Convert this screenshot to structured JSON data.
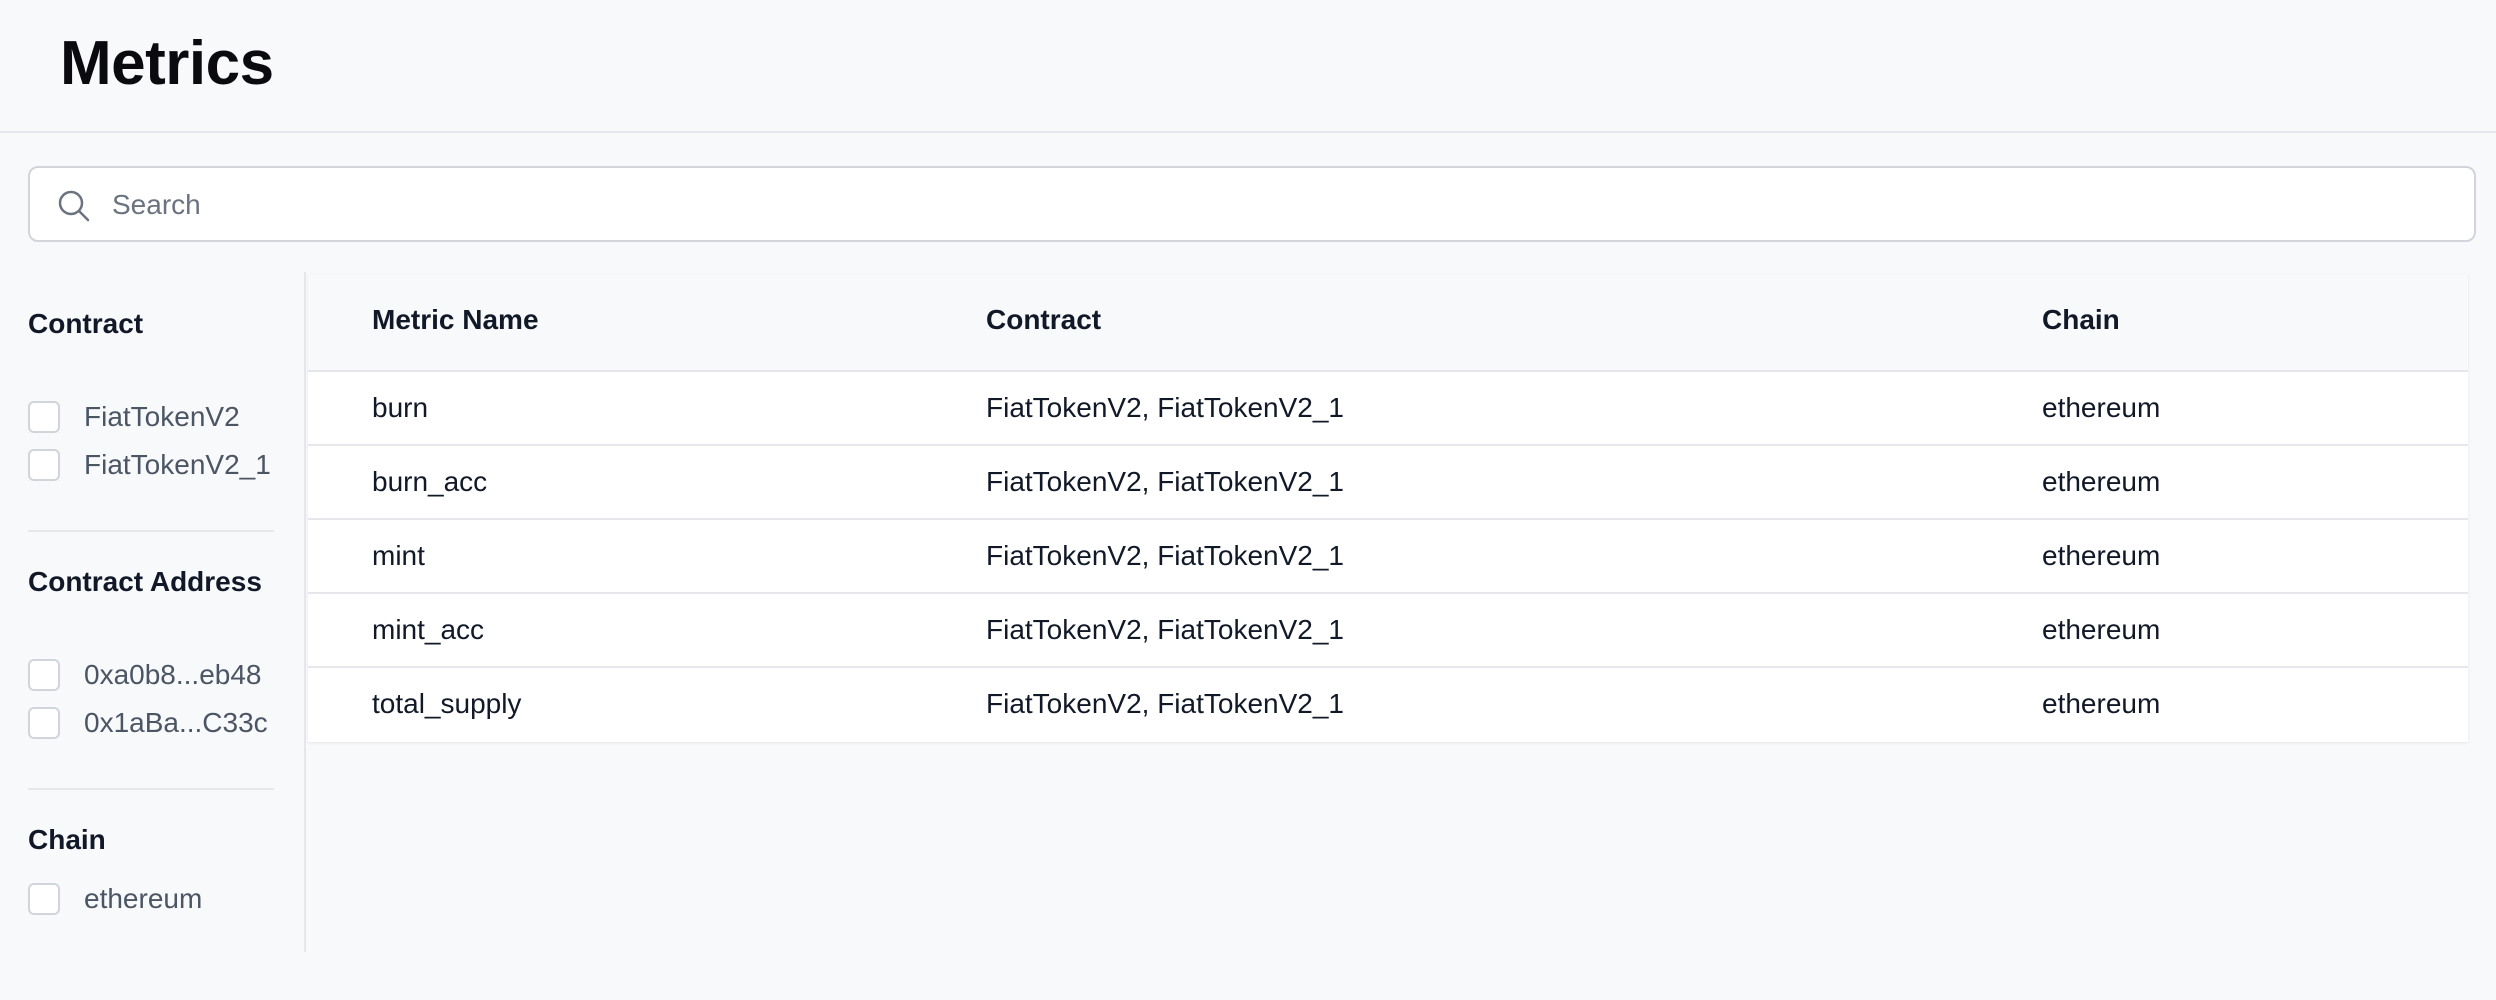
{
  "header": {
    "title": "Metrics"
  },
  "search": {
    "placeholder": "Search",
    "value": ""
  },
  "filters": [
    {
      "title": "Contract",
      "options": [
        "FiatTokenV2",
        "FiatTokenV2_1"
      ]
    },
    {
      "title": "Contract Address",
      "options": [
        "0xa0b8...eb48",
        "0x1aBa...C33c"
      ]
    },
    {
      "title": "Chain",
      "options": [
        "ethereum"
      ]
    }
  ],
  "table": {
    "columns": [
      "Metric Name",
      "Contract",
      "Chain"
    ],
    "rows": [
      [
        "burn",
        "FiatTokenV2, FiatTokenV2_1",
        "ethereum"
      ],
      [
        "burn_acc",
        "FiatTokenV2, FiatTokenV2_1",
        "ethereum"
      ],
      [
        "mint",
        "FiatTokenV2, FiatTokenV2_1",
        "ethereum"
      ],
      [
        "mint_acc",
        "FiatTokenV2, FiatTokenV2_1",
        "ethereum"
      ],
      [
        "total_supply",
        "FiatTokenV2, FiatTokenV2_1",
        "ethereum"
      ]
    ]
  },
  "icons": {
    "search": "search-icon",
    "checkbox": "checkbox-unchecked"
  },
  "colors": {
    "background": "#f8f9fb",
    "border": "#e5e7eb",
    "text": "#111827",
    "muted": "#4b5563"
  }
}
